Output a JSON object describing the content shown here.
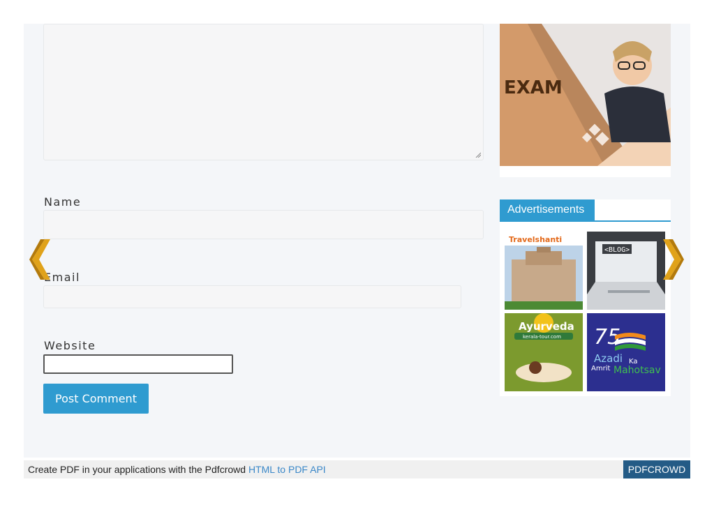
{
  "form": {
    "name_label": "Name",
    "email_label": "Email",
    "website_label": "Website",
    "submit_label": "Post Comment"
  },
  "sidebar": {
    "banner_text": "EXAM",
    "ads_title": "Advertisements",
    "ads": [
      {
        "brand": "Travelshanti"
      },
      {
        "brand": "<BLOG>"
      },
      {
        "brand": "Ayurveda",
        "sub": "kerala-tour.com"
      },
      {
        "brand": "75",
        "line1": "Azadi",
        "line2": "Ka",
        "line3": "Amrit",
        "line4": "Mahotsav"
      }
    ]
  },
  "footer": {
    "text": "Create PDF in your applications with the Pdfcrowd ",
    "link": "HTML to PDF API",
    "badge": "PDFCROWD"
  },
  "colors": {
    "accent": "#2f9bd0",
    "arrow": "#e0a21a",
    "badge": "#245b86"
  }
}
